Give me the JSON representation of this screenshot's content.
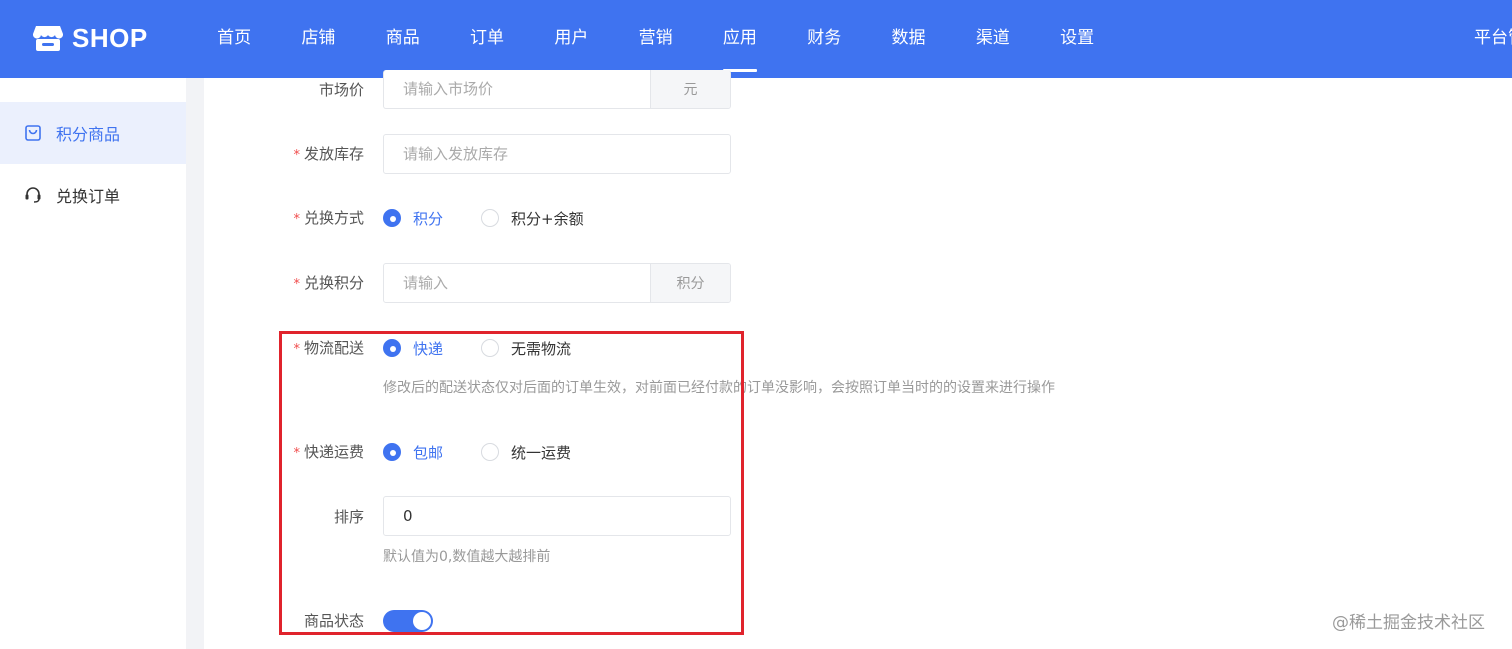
{
  "header": {
    "logo_text": "SHOP",
    "nav": [
      "首页",
      "店铺",
      "商品",
      "订单",
      "用户",
      "营销",
      "应用",
      "财务",
      "数据",
      "渠道",
      "设置"
    ],
    "active_nav": "应用",
    "platform_label": "平台管"
  },
  "sidebar": {
    "items": [
      {
        "label": "积分商品",
        "icon": "bag-icon",
        "active": true
      },
      {
        "label": "兑换订单",
        "icon": "headset-icon",
        "active": false
      }
    ]
  },
  "form": {
    "market_price": {
      "label": "市场价",
      "placeholder": "请输入市场价",
      "suffix": "元"
    },
    "stock": {
      "label": "发放库存",
      "placeholder": "请输入发放库存"
    },
    "exchange_mode": {
      "label": "兑换方式",
      "options": [
        "积分",
        "积分+余额"
      ],
      "selected": "积分"
    },
    "exchange_points": {
      "label": "兑换积分",
      "placeholder": "请输入",
      "suffix": "积分"
    },
    "delivery": {
      "label": "物流配送",
      "options": [
        "快递",
        "无需物流"
      ],
      "selected": "快递",
      "hint": "修改后的配送状态仅对后面的订单生效，对前面已经付款的订单没影响，会按照订单当时的的设置来进行操作"
    },
    "shipping_fee": {
      "label": "快递运费",
      "options": [
        "包邮",
        "统一运费"
      ],
      "selected": "包邮"
    },
    "sort": {
      "label": "排序",
      "value": "0",
      "hint": "默认值为0,数值越大越排前"
    },
    "status": {
      "label": "商品状态",
      "enabled": true
    }
  },
  "watermark": "@稀土掘金技术社区",
  "colors": {
    "primary": "#3f73f0",
    "required": "#f04a4a",
    "highlight": "#e0232c"
  }
}
